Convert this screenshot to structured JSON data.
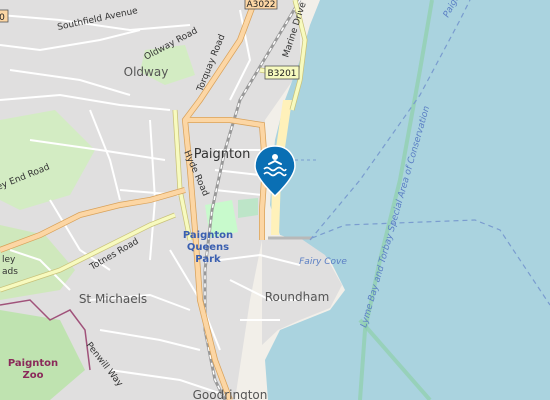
{
  "places": {
    "paignton": "Paignton",
    "oldway": "Oldway",
    "st_michaels": "St Michaels",
    "roundham": "Roundham",
    "goodrington": "Goodrington",
    "queens_park_line1": "Paignton",
    "queens_park_line2": "Queens",
    "queens_park_line3": "Park",
    "fairy_cove": "Fairy Cove",
    "paignton_water": "Paignton",
    "zoo_line1": "Paignton",
    "zoo_line2": "Zoo",
    "conservation": "Lyme Bay and Torbay Special Area of Conservation"
  },
  "roads": {
    "southfield": "Southfield Avenue",
    "oldway_road": "Oldway Road",
    "torquay_road": "Torquay Road",
    "marine_drive": "Marine Drive",
    "hyde_road": "Hyde Road",
    "totnes_road": "Totnes Road",
    "preston_down_partial": "ey End Road",
    "penwill_way": "Penwill Way",
    "lady_partial1": "ley",
    "lady_partial2": "ads"
  },
  "shields": {
    "a3022": "A3022",
    "b3201": "B3201",
    "edge_partial": "0"
  },
  "marker": {
    "icon": "swimming-icon",
    "color": "#0a6fb4"
  },
  "colors": {
    "sea": "#aad3df",
    "land": "#f2efe9",
    "residential": "#e0dfdf",
    "park": "#c8facc",
    "rail": "#999999",
    "primary_road": "#fcd6a4",
    "secondary_road": "#f7fabf",
    "beach": "#fff1ba",
    "boundary": "#7a9ccf"
  }
}
